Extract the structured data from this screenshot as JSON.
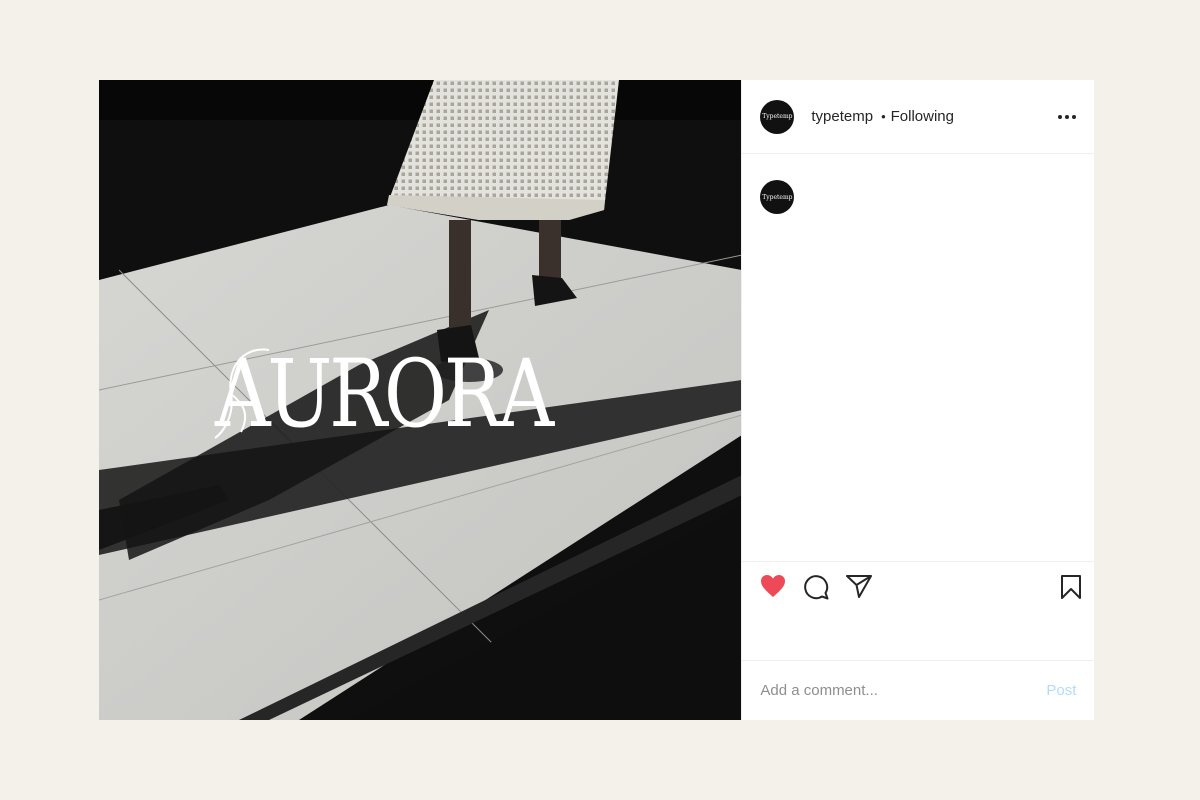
{
  "post": {
    "image": {
      "overlay_text": "AURORA",
      "description": "woman walking on sunlit tiled floor with long shadows"
    },
    "header": {
      "avatar_text": "Typetemp",
      "username": "typetemp",
      "separator": "•",
      "follow_status": "Following"
    },
    "caption": {
      "avatar_text": "Typetemp"
    },
    "actions": {
      "liked": true,
      "like_color": "#ed4956"
    },
    "comment": {
      "placeholder": "Add a comment...",
      "post_label": "Post",
      "post_color": "#b3dbff"
    }
  },
  "colors": {
    "page_background": "#f4f0ea",
    "panel_background": "#ffffff",
    "text": "#262626",
    "muted_text": "#8e8e8e"
  }
}
